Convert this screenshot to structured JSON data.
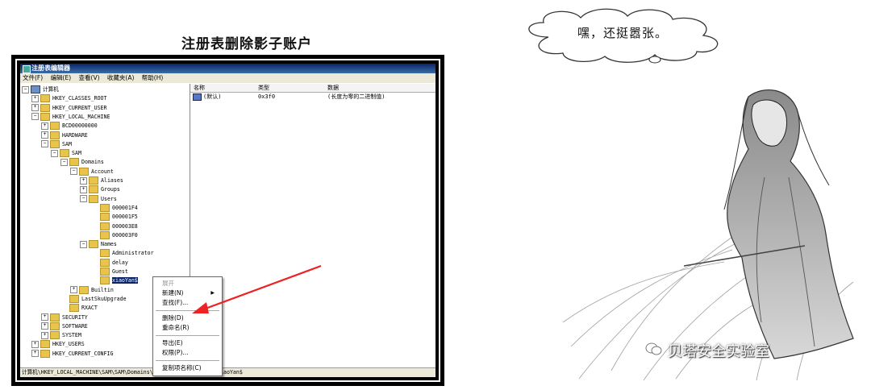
{
  "slide_title": "注册表删除影子账户",
  "bubble_text": "嘿，还挺嚣张。",
  "watermark_text": "贝塔安全实验室",
  "regedit": {
    "window_title": "注册表编辑器",
    "menu": [
      "文件(F)",
      "编辑(E)",
      "查看(V)",
      "收藏夹(A)",
      "帮助(H)"
    ],
    "tree": [
      {
        "label": "计算机",
        "exp": "⊟",
        "icon": "pc"
      },
      {
        "label": "HKEY_CLASSES_ROOT",
        "exp": "⊞",
        "icon": "folder"
      },
      {
        "label": "HKEY_CURRENT_USER",
        "exp": "⊞",
        "icon": "folder"
      },
      {
        "label": "HKEY_LOCAL_MACHINE",
        "exp": "⊟",
        "icon": "folder"
      },
      {
        "label": "BCD00000000",
        "exp": "⊞",
        "icon": "folder"
      },
      {
        "label": "HARDWARE",
        "exp": "⊞",
        "icon": "folder"
      },
      {
        "label": "SAM",
        "exp": "⊟",
        "icon": "folder"
      },
      {
        "label": "SAM",
        "exp": "⊟",
        "icon": "folder"
      },
      {
        "label": "Domains",
        "exp": "⊟",
        "icon": "folder"
      },
      {
        "label": "Account",
        "exp": "⊟",
        "icon": "folder"
      },
      {
        "label": "Aliases",
        "exp": "⊞",
        "icon": "folder"
      },
      {
        "label": "Groups",
        "exp": "⊞",
        "icon": "folder"
      },
      {
        "label": "Users",
        "exp": "⊟",
        "icon": "folder"
      },
      {
        "label": "000001F4",
        "exp": "",
        "icon": "folder"
      },
      {
        "label": "000001F5",
        "exp": "",
        "icon": "folder"
      },
      {
        "label": "000003E8",
        "exp": "",
        "icon": "folder"
      },
      {
        "label": "000003F0",
        "exp": "",
        "icon": "folder"
      },
      {
        "label": "Names",
        "exp": "⊟",
        "icon": "folder"
      },
      {
        "label": "Administrator",
        "exp": "",
        "icon": "folder"
      },
      {
        "label": "delay",
        "exp": "",
        "icon": "folder"
      },
      {
        "label": "Guest",
        "exp": "",
        "icon": "folder"
      },
      {
        "label": "xiaoYan$",
        "exp": "",
        "icon": "folder",
        "selected": true
      },
      {
        "label": "Builtin",
        "exp": "⊞",
        "icon": "folder"
      },
      {
        "label": "LastSkuUpgrade",
        "exp": "",
        "icon": "folder"
      },
      {
        "label": "RXACT",
        "exp": "",
        "icon": "folder"
      },
      {
        "label": "SECURITY",
        "exp": "⊞",
        "icon": "folder"
      },
      {
        "label": "SOFTWARE",
        "exp": "⊞",
        "icon": "folder"
      },
      {
        "label": "SYSTEM",
        "exp": "⊞",
        "icon": "folder"
      },
      {
        "label": "HKEY_USERS",
        "exp": "⊞",
        "icon": "folder"
      },
      {
        "label": "HKEY_CURRENT_CONFIG",
        "exp": "⊞",
        "icon": "folder"
      }
    ],
    "columns": {
      "name": "名称",
      "type": "类型",
      "data": "数据"
    },
    "rows": [
      {
        "name": "(默认)",
        "type": "0x3f0",
        "data": "(长度为零的二进制值)"
      }
    ],
    "context_menu": {
      "expand": "展开",
      "new": "新建(N)",
      "find": "查找(F)...",
      "delete": "删除(D)",
      "rename": "重命名(R)",
      "export": "导出(E)",
      "permissions": "权限(P)...",
      "copy_key_name": "复制项名称(C)"
    },
    "status": "计算机\\HKEY_LOCAL_MACHINE\\SAM\\SAM\\Domains\\Account\\Users\\Names\\xiaoYan$"
  },
  "colors": {
    "arrow": "#ee2222",
    "selection": "#0a246a",
    "folder": "#e8c44a"
  }
}
